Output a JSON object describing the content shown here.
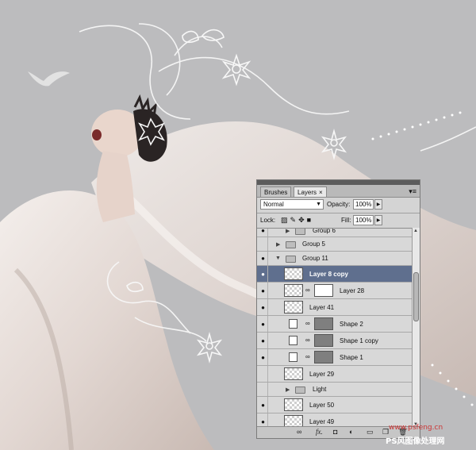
{
  "panel": {
    "tabs": [
      {
        "label": "Brushes",
        "active": false
      },
      {
        "label": "Layers",
        "active": true
      }
    ],
    "tab_close": "×",
    "blend_mode": "Normal",
    "opacity_label": "Opacity:",
    "opacity_value": "100%",
    "lock_label": "Lock:",
    "fill_label": "Fill:",
    "fill_value": "100%",
    "layers": [
      {
        "name": "Group 6",
        "type": "group",
        "visible": true,
        "expanded": false,
        "indent": 1
      },
      {
        "name": "Group 5",
        "type": "group",
        "visible": false,
        "expanded": false,
        "indent": 0
      },
      {
        "name": "Group 11",
        "type": "group",
        "visible": true,
        "expanded": true,
        "indent": 0
      },
      {
        "name": "Layer 8 copy",
        "type": "layer",
        "visible": true,
        "selected": true
      },
      {
        "name": "Layer 28",
        "type": "masked",
        "visible": true
      },
      {
        "name": "Layer 41",
        "type": "layer",
        "visible": true
      },
      {
        "name": "Shape 2",
        "type": "shape",
        "visible": true
      },
      {
        "name": "Shape 1 copy",
        "type": "shape",
        "visible": true
      },
      {
        "name": "Shape 1",
        "type": "shape",
        "visible": true
      },
      {
        "name": "Layer 29",
        "type": "layer",
        "visible": false
      },
      {
        "name": "Light",
        "type": "group",
        "visible": false,
        "expanded": false,
        "indent": 1
      },
      {
        "name": "Layer 50",
        "type": "layer",
        "visible": true
      },
      {
        "name": "Layer 49",
        "type": "layer",
        "visible": true
      }
    ]
  },
  "watermark": {
    "url": "www.psfeng.cn",
    "site": "PS风图像处理网"
  },
  "colors": {
    "background": "#bcbcbe",
    "selected_row": "#5f6f8e",
    "panel": "#d4d4d4"
  }
}
